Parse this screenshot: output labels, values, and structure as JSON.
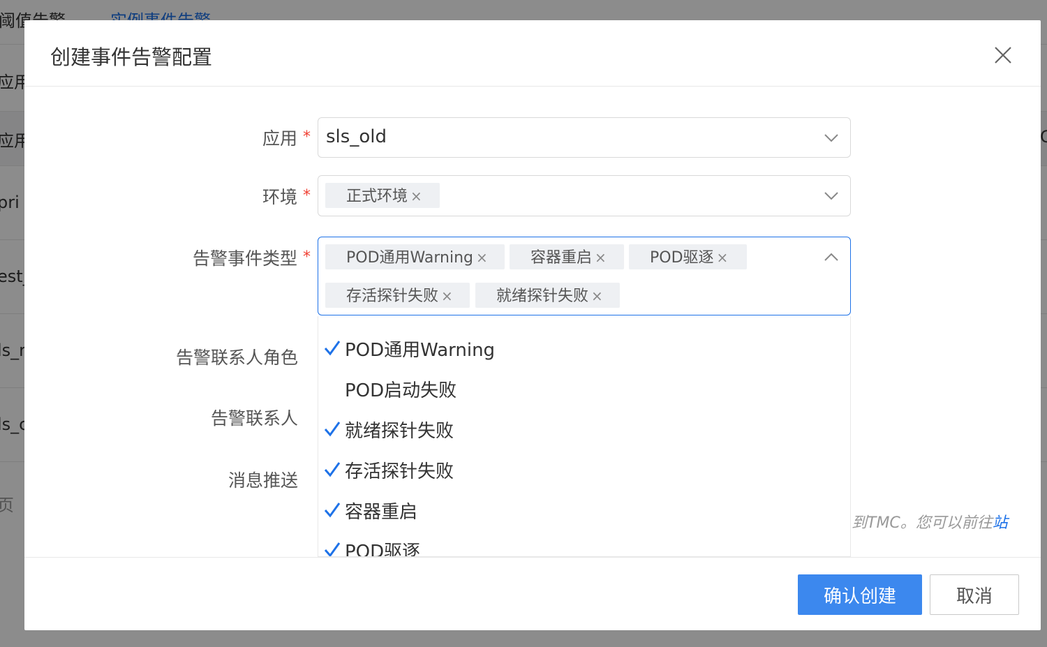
{
  "background": {
    "tabs": [
      "阈值告警",
      "实例事件告警"
    ],
    "rows": [
      "应用",
      "应用",
      "pri",
      "est_",
      "ls_r",
      "ls_c",
      "页"
    ],
    "right_fragment": "C"
  },
  "modal": {
    "title": "创建事件告警配置",
    "close_icon": "close-icon"
  },
  "form": {
    "app": {
      "label": "应用",
      "required": "*",
      "value": "sls_old"
    },
    "env": {
      "label": "环境",
      "required": "*",
      "tags": [
        "正式环境"
      ]
    },
    "event_type": {
      "label": "告警事件类型",
      "required": "*",
      "tags": [
        "POD通用Warning",
        "容器重启",
        "POD驱逐",
        "存活探针失败",
        "就绪探针失败"
      ]
    },
    "contact_role": {
      "label": "告警联系人角色"
    },
    "contact": {
      "label": "告警联系人"
    },
    "push": {
      "label": "消息推送"
    },
    "hint": {
      "text": "到TMC。您可以前往",
      "link": "站"
    }
  },
  "dropdown": {
    "options": [
      {
        "label": "POD通用Warning",
        "checked": true
      },
      {
        "label": "POD启动失败",
        "checked": false
      },
      {
        "label": "就绪探针失败",
        "checked": true
      },
      {
        "label": "存活探针失败",
        "checked": true
      },
      {
        "label": "容器重启",
        "checked": true
      },
      {
        "label": "POD驱逐",
        "checked": true
      }
    ]
  },
  "footer": {
    "confirm_label": "确认创建",
    "cancel_label": "取消"
  },
  "colors": {
    "primary": "#3c88ee",
    "required": "#f04134",
    "check": "#1e72e8"
  }
}
